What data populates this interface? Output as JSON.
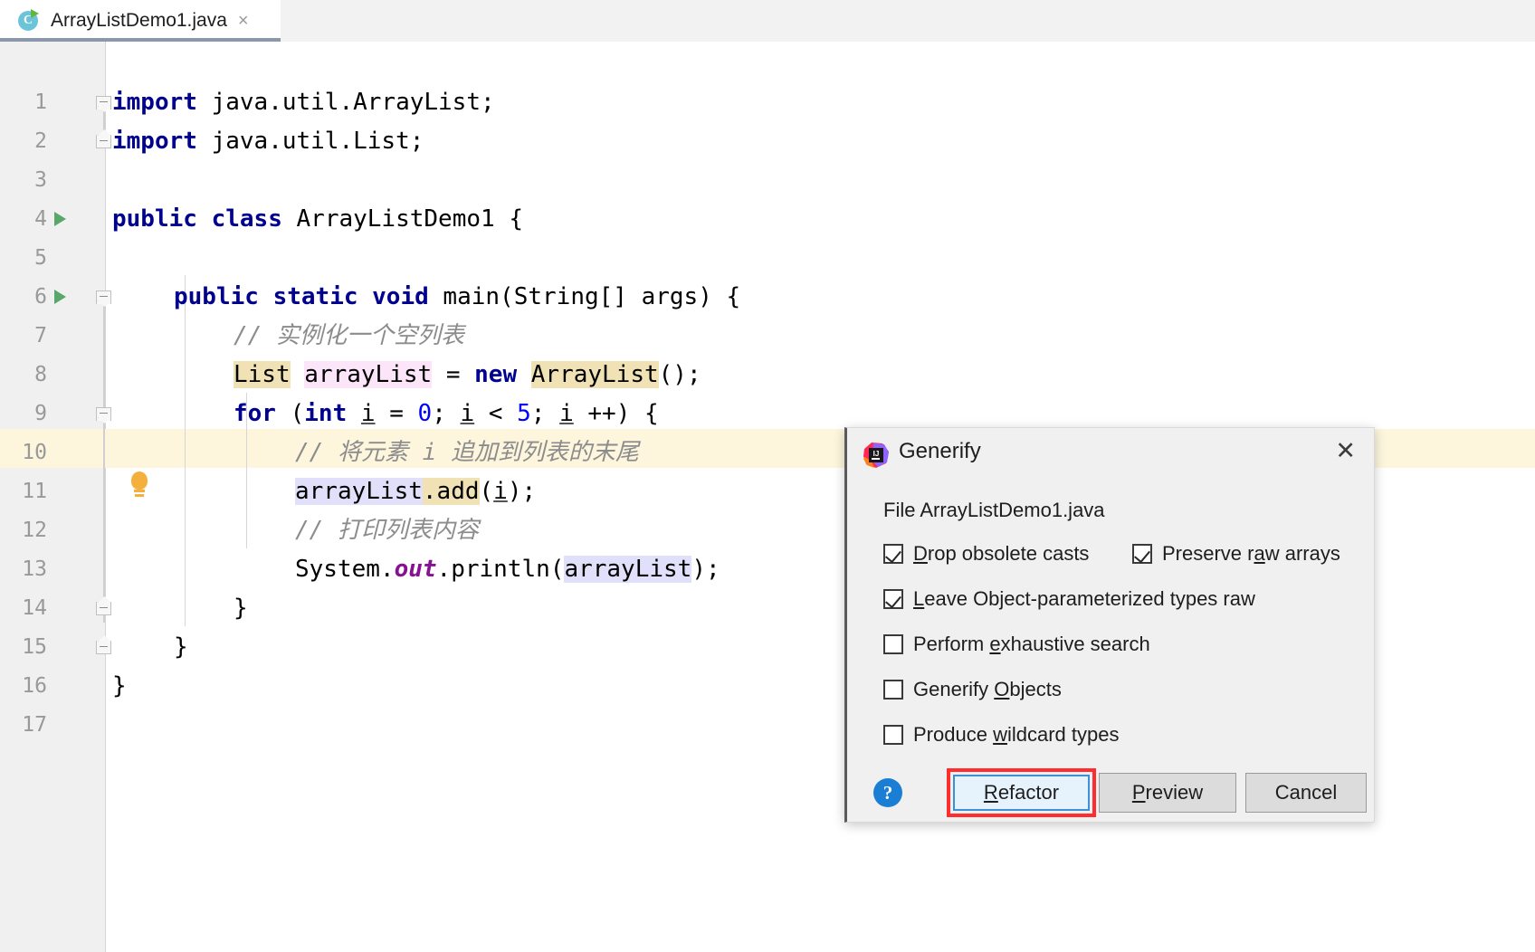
{
  "tab": {
    "title": "ArrayListDemo1.java",
    "icon": "java-class-icon",
    "run_marker": "green-run-triangle",
    "close": "×"
  },
  "editor": {
    "lines": [
      {
        "n": "1",
        "text": "import java.util.ArrayList;"
      },
      {
        "n": "2",
        "text": "import java.util.List;"
      },
      {
        "n": "3",
        "text": ""
      },
      {
        "n": "4",
        "text": "public class ArrayListDemo1 {"
      },
      {
        "n": "5",
        "text": ""
      },
      {
        "n": "6",
        "text": "    public static void main(String[] args) {"
      },
      {
        "n": "7",
        "text": "        // 实例化一个空列表"
      },
      {
        "n": "8",
        "text": "        List arrayList = new ArrayList();"
      },
      {
        "n": "9",
        "text": "        for (int i = 0; i < 5; i ++) {"
      },
      {
        "n": "10",
        "text": "            // 将元素 i 追加到列表的末尾"
      },
      {
        "n": "11",
        "text": "            arrayList.add(i);"
      },
      {
        "n": "12",
        "text": "            // 打印列表内容"
      },
      {
        "n": "13",
        "text": "            System.out.println(arrayList);"
      },
      {
        "n": "14",
        "text": "        }"
      },
      {
        "n": "15",
        "text": "    }"
      },
      {
        "n": "16",
        "text": "}"
      },
      {
        "n": "17",
        "text": ""
      }
    ],
    "tokens": {
      "import": "import",
      "java_util_arraylist": " java.util.ArrayList;",
      "java_util_list": " java.util.List;",
      "public": "public",
      "class": "class",
      "static": "static",
      "void": "void",
      "new": "new",
      "for": "for",
      "int": "int",
      "classname": " ArrayListDemo1 {",
      "main_sig": " main(String[] args) {",
      "comment1": "// 实例化一个空列表",
      "comment2": "// 将元素 i 追加到列表的末尾",
      "comment3": "// 打印列表内容",
      "type_list": "List",
      "var_arraylist": "arrayList",
      "equals": " = ",
      "ctor_arraylist": "ArrayList",
      "ctor_tail": "();",
      "for_open": " (",
      "i": "i",
      "for_init": " = ",
      "zero": "0",
      "semi1": "; ",
      "lt": " < ",
      "five": "5",
      "semi2": "; ",
      "incr": " ++) {",
      "dot_add": ".add",
      "add_open": "(",
      "add_close": ");",
      "system": "System.",
      "out": "out",
      "println": ".println(",
      "println_close": ");",
      "brace_close": "}"
    },
    "gutter": {
      "run_lines": [
        "4",
        "6"
      ],
      "fold_lines": [
        "1",
        "2",
        "6",
        "9",
        "14",
        "15"
      ],
      "bulb_line": "11",
      "bulb_icon": "intention-lightbulb-icon"
    },
    "caret_line": "11"
  },
  "dialog": {
    "title": "Generify",
    "logo": "intellij-idea-icon",
    "close_label": "✕",
    "file_label": "File ArrayListDemo1.java",
    "checkboxes": [
      {
        "label": "Drop obsolete casts",
        "pre": "",
        "mn": "D",
        "post": "rop obsolete casts",
        "checked": true,
        "name": "drop-obsolete-casts"
      },
      {
        "label": "Preserve raw arrays",
        "pre": "Preserve r",
        "mn": "a",
        "post": "w arrays",
        "checked": true,
        "name": "preserve-raw-arrays"
      },
      {
        "label": "Leave Object-parameterized types raw",
        "pre": "",
        "mn": "L",
        "post": "eave Object-parameterized types raw",
        "checked": true,
        "name": "leave-object-parameterized-types-raw"
      },
      {
        "label": "Perform exhaustive search",
        "pre": "Perform ",
        "mn": "e",
        "post": "xhaustive search",
        "checked": false,
        "name": "perform-exhaustive-search"
      },
      {
        "label": "Generify Objects",
        "pre": "Generify ",
        "mn": "O",
        "post": "bjects",
        "checked": false,
        "name": "generify-objects"
      },
      {
        "label": "Produce wildcard types",
        "pre": "Produce ",
        "mn": "w",
        "post": "ildcard types",
        "checked": false,
        "name": "produce-wildcard-types"
      }
    ],
    "help_label": "?",
    "buttons": {
      "refactor": {
        "pre": "",
        "mn": "R",
        "post": "efactor"
      },
      "preview": {
        "pre": "",
        "mn": "P",
        "post": "review"
      },
      "cancel": {
        "pre": "Cancel",
        "mn": "",
        "post": ""
      }
    },
    "annotation": {
      "shape": "red-rectangle",
      "target": "refactor-button",
      "color": "#ff2d2d"
    }
  },
  "colors": {
    "keyword": "#00008f",
    "number": "#0000ff",
    "comment": "#8c8c8c",
    "static_field": "#871094",
    "highlight_tan": "#f0e2b4",
    "highlight_pink": "#fce4f9",
    "highlight_lavender": "#e0e0fa",
    "caret_row": "#fdf6dd",
    "accent_blue": "#1a7fd4",
    "annotation_red": "#ff2d2d",
    "tab_underline": "#8b98ab"
  }
}
